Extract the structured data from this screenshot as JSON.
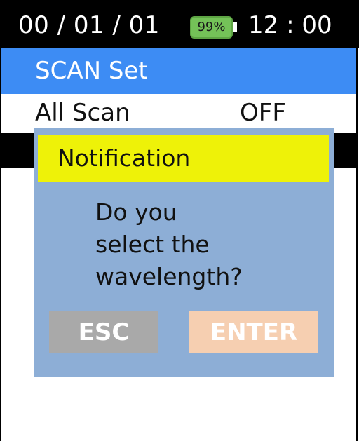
{
  "status_bar": {
    "date": "00 / 01 / 01",
    "battery_percent": "99%",
    "time": "12 : 00"
  },
  "title_bar": {
    "title": "SCAN Set"
  },
  "menu": {
    "items": [
      {
        "label": "All Scan",
        "value": "OFF"
      }
    ]
  },
  "dialog": {
    "title": "Notification",
    "message_lines": [
      "Do you",
      "select the",
      "wavelength?"
    ],
    "esc_label": "ESC",
    "enter_label": "ENTER"
  },
  "colors": {
    "status_bar_bg": "#000000",
    "title_bar_bg": "#3d8cf4",
    "battery_green": "#74c258",
    "dialog_bg": "#8daed6",
    "dialog_header_bg": "#eef208",
    "esc_button_bg": "#a9a9a9",
    "enter_button_bg": "#f6cfb1"
  }
}
